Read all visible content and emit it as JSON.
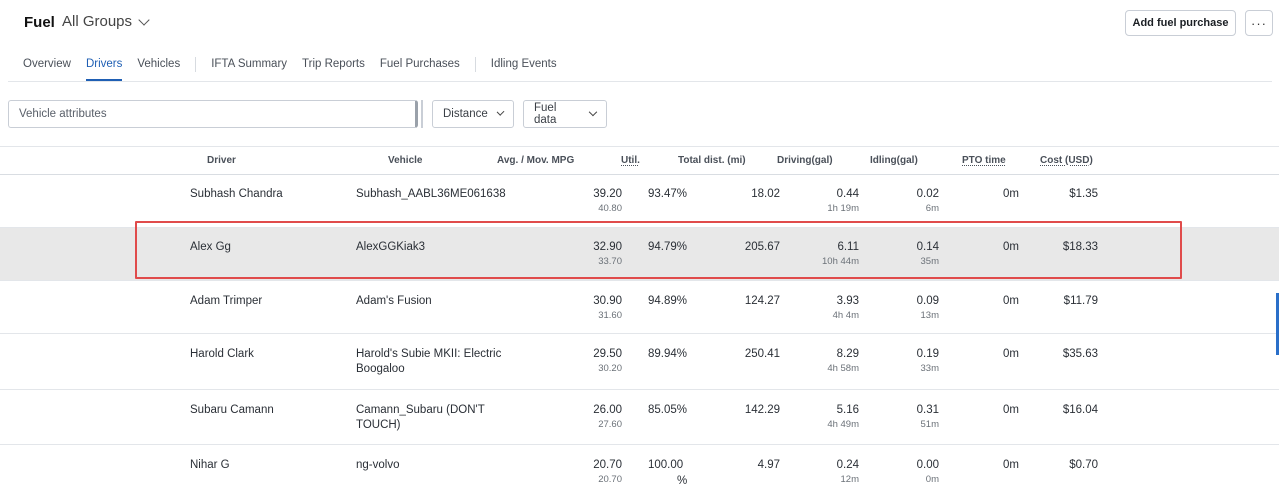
{
  "header": {
    "title": "Fuel",
    "group_label": "All Groups",
    "add_button": "Add fuel purchase",
    "more_button": "···"
  },
  "tabs": [
    {
      "label": "Overview"
    },
    {
      "label": "Drivers",
      "active": true
    },
    {
      "label": "Vehicles"
    },
    {
      "label": "IFTA Summary"
    },
    {
      "label": "Trip Reports"
    },
    {
      "label": "Fuel Purchases"
    },
    {
      "label": "Idling Events"
    }
  ],
  "filters": {
    "search_placeholder": "Vehicle attributes",
    "distance_label": "Distance",
    "fuel_data_label": "Fuel data"
  },
  "table": {
    "columns": {
      "driver": "Driver",
      "vehicle": "Vehicle",
      "mpg": "Avg. / Mov. MPG",
      "util": "Util.",
      "dist": "Total dist. (mi)",
      "driving": "Driving(gal)",
      "idling": "Idling(gal)",
      "pto": "PTO time",
      "cost": "Cost (USD)"
    },
    "rows": [
      {
        "driver": "Subhash Chandra",
        "vehicle": "Subhash_AABL36ME061638",
        "vehicle2": "",
        "avg_mpg": "39.20",
        "mov_mpg": "40.80",
        "util": "93.47%",
        "util2": "",
        "dist": "18.02",
        "driving": "0.44",
        "driving_time": "1h 19m",
        "idling": "0.02",
        "idling_time": "6m",
        "pto": "0m",
        "cost": "$1.35"
      },
      {
        "driver": "Alex Gg",
        "vehicle": "AlexGGKiak3",
        "vehicle2": "",
        "avg_mpg": "32.90",
        "mov_mpg": "33.70",
        "util": "94.79%",
        "util2": "",
        "dist": "205.67",
        "driving": "6.11",
        "driving_time": "10h 44m",
        "idling": "0.14",
        "idling_time": "35m",
        "pto": "0m",
        "cost": "$18.33"
      },
      {
        "driver": "Adam Trimper",
        "vehicle": "Adam's Fusion",
        "vehicle2": "",
        "avg_mpg": "30.90",
        "mov_mpg": "31.60",
        "util": "94.89%",
        "util2": "",
        "dist": "124.27",
        "driving": "3.93",
        "driving_time": "4h 4m",
        "idling": "0.09",
        "idling_time": "13m",
        "pto": "0m",
        "cost": "$11.79"
      },
      {
        "driver": "Harold Clark",
        "vehicle": "Harold's Subie MKII: Electric",
        "vehicle2": "Boogaloo",
        "avg_mpg": "29.50",
        "mov_mpg": "30.20",
        "util": "89.94%",
        "util2": "",
        "dist": "250.41",
        "driving": "8.29",
        "driving_time": "4h 58m",
        "idling": "0.19",
        "idling_time": "33m",
        "pto": "0m",
        "cost": "$35.63"
      },
      {
        "driver": "Subaru Camann",
        "vehicle": "Camann_Subaru (DON'T",
        "vehicle2": "TOUCH)",
        "avg_mpg": "26.00",
        "mov_mpg": "27.60",
        "util": "85.05%",
        "util2": "",
        "dist": "142.29",
        "driving": "5.16",
        "driving_time": "4h 49m",
        "idling": "0.31",
        "idling_time": "51m",
        "pto": "0m",
        "cost": "$16.04"
      },
      {
        "driver": "Nihar G",
        "vehicle": "ng-volvo",
        "vehicle2": "",
        "avg_mpg": "20.70",
        "mov_mpg": "20.70",
        "util": "100.00",
        "util2": "%",
        "dist": "4.97",
        "driving": "0.24",
        "driving_time": "12m",
        "idling": "0.00",
        "idling_time": "0m",
        "pto": "0m",
        "cost": "$0.70"
      }
    ]
  },
  "colors": {
    "accent": "#1f5fb4",
    "highlight_border": "#e04b4b",
    "selected_row": "#e8e8e8"
  }
}
